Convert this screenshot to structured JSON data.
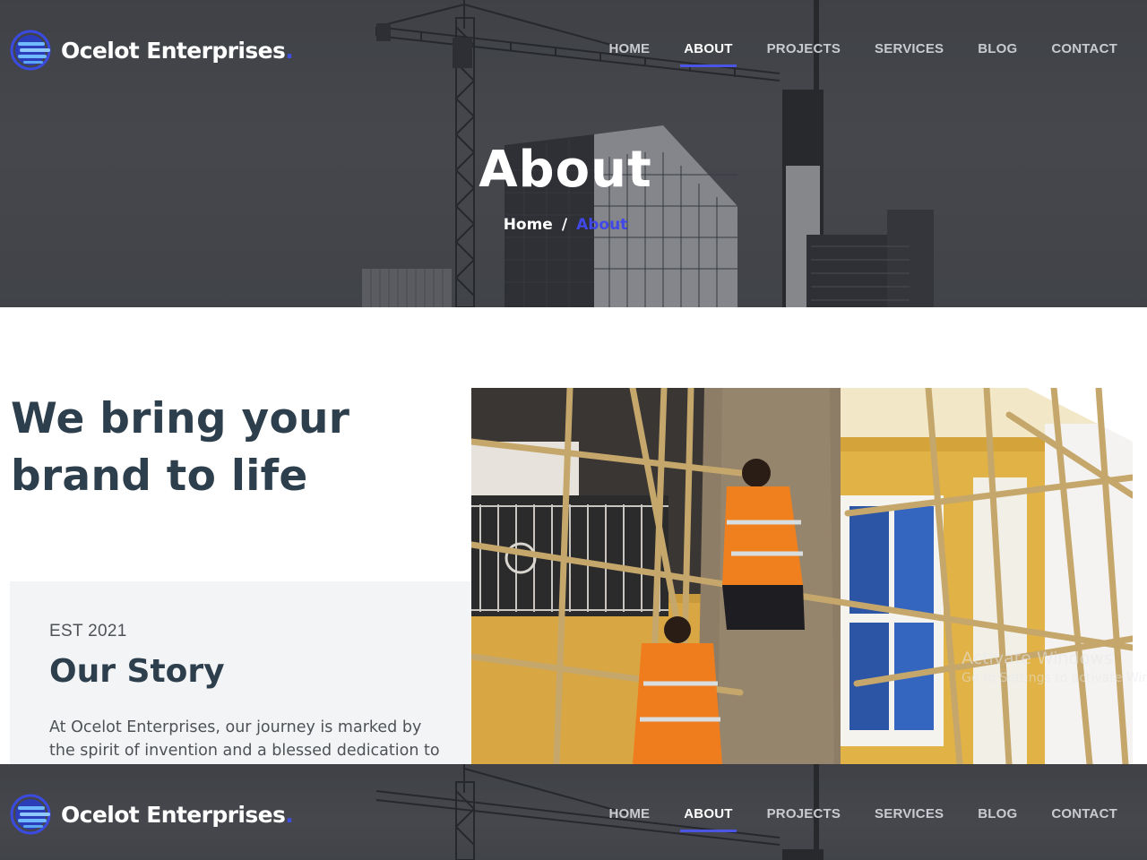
{
  "brand": {
    "name": "Ocelot Enterprises",
    "dot": "."
  },
  "nav": {
    "items": [
      {
        "label": "HOME",
        "active": false
      },
      {
        "label": "ABOUT",
        "active": true
      },
      {
        "label": "PROJECTS",
        "active": false
      },
      {
        "label": "SERVICES",
        "active": false
      },
      {
        "label": "BLOG",
        "active": false
      },
      {
        "label": "CONTACT",
        "active": false
      }
    ]
  },
  "hero": {
    "title": "About",
    "breadcrumb": {
      "home": "Home",
      "separator": "/",
      "current": "About"
    }
  },
  "main": {
    "tagline_line1": "We bring your",
    "tagline_line2": "brand to life"
  },
  "story": {
    "est": "EST 2021",
    "title": "Our Story",
    "body_line1": "At Ocelot Enterprises, our journey is marked by",
    "body_line2": "the spirit of invention and a blessed dedication to"
  },
  "watermark": {
    "title": "Activate Windows",
    "subtitle": "Go to Settings to activate Windows."
  },
  "colors": {
    "accent": "#4148e8",
    "heading": "#2d3e4c",
    "hero_overlay": "#505257",
    "story_bg": "#f3f4f6"
  }
}
